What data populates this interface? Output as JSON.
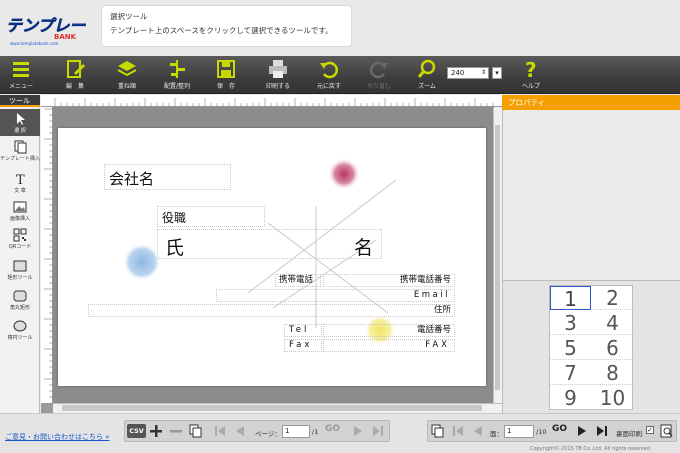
{
  "header": {
    "logo_text": "テンプレートBANK",
    "logo_url_text": "www.templatebank.com",
    "tip_title": "選択ツール",
    "tip_body": "テンプレート上のスペースをクリックして選択できるツールです。"
  },
  "toolbar": {
    "menu": "メニュー",
    "edit": "編　集",
    "layer": "重ね順",
    "arrange": "配置/整列",
    "save": "保　存",
    "print": "印刷する",
    "undo": "元に戻す",
    "redo": "やり直し",
    "zoom": "ズーム",
    "zoom_value": "240",
    "help": "ヘルプ"
  },
  "tools": {
    "heading": "ツール",
    "items": [
      "選 択",
      "テンプレート挿入",
      "文 章",
      "画像挿入",
      "QRコード",
      "矩形ツール",
      "角丸矩形",
      "楕円ツール"
    ]
  },
  "card": {
    "company": "会社名",
    "title": "役職",
    "name_left": "氏",
    "name_right": "名",
    "mobile_label": "携帯電話",
    "mobile_number": "携帯電話番号",
    "email": "Email",
    "address": "住所",
    "tel_label": "Tel",
    "tel_number": "電話番号",
    "fax_label": "Fax",
    "fax_number": "FAX"
  },
  "properties": {
    "heading": "プロパティ"
  },
  "pages": [
    "1",
    "2",
    "3",
    "4",
    "5",
    "6",
    "7",
    "8",
    "9",
    "10"
  ],
  "footer": {
    "link": "ご意見・お問い合わせはこちら »",
    "csv": "CSV",
    "page_label": "ページ：",
    "page_value": "1",
    "page_total": "/1",
    "go": "GO",
    "sheet_label": "面：",
    "sheet_value": "1",
    "sheet_total": "/10",
    "sheet_go": "GO",
    "print_check_label": "裏面印刷",
    "copyright": "Copyright© 2015 TB Co.,Ltd. All rights reserved."
  },
  "colors": {
    "accent": "#f5a000",
    "toolbar": "#3d3d3d",
    "icon": "#c8d900",
    "selection": "#3355cc"
  }
}
